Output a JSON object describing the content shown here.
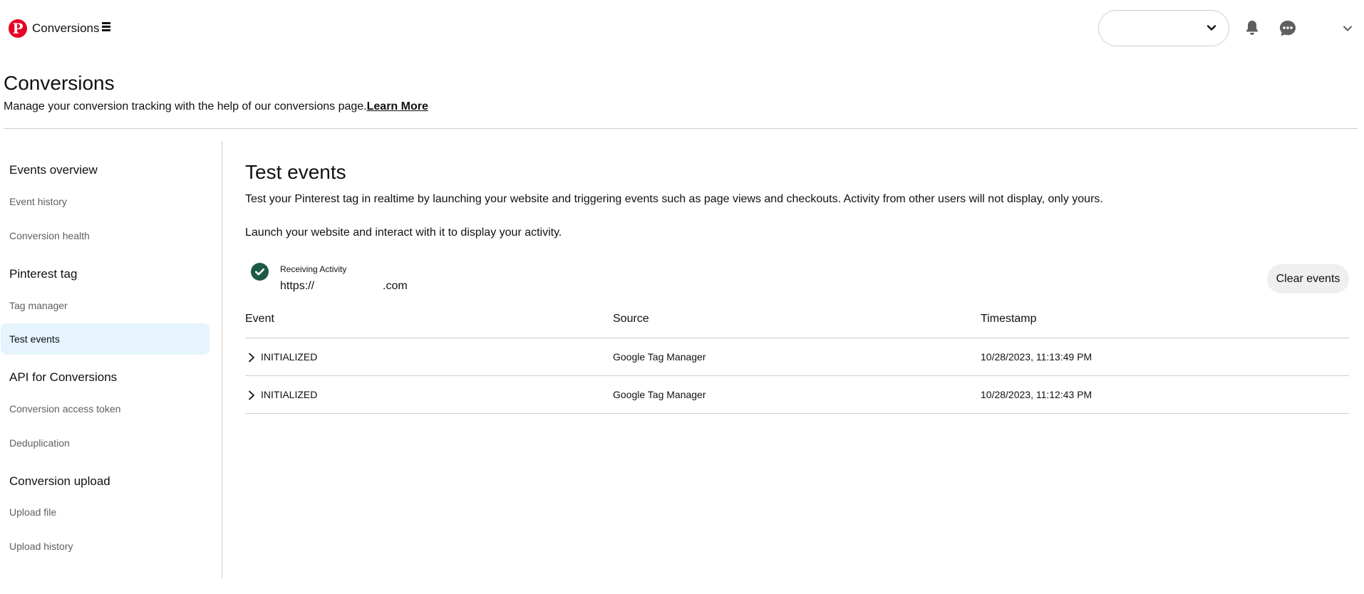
{
  "topbar": {
    "app_name": "Conversions",
    "icons": {
      "logo": "pinterest-logo",
      "menu": "menu-icon",
      "account_select_chevron": "chevron-down-icon",
      "notifications": "bell-icon",
      "messages": "chat-icon",
      "profile_menu": "chevron-down-icon"
    }
  },
  "header": {
    "title": "Conversions",
    "subtitle": "Manage your conversion tracking with the help of our conversions page.",
    "learn_more": "Learn More"
  },
  "sidebar": {
    "sections": [
      {
        "title": "Events overview",
        "items": [
          "Event history",
          "Conversion health"
        ]
      },
      {
        "title": "Pinterest tag",
        "items": [
          "Tag manager",
          "Test events"
        ]
      },
      {
        "title": "API for Conversions",
        "items": [
          "Conversion access token",
          "Deduplication"
        ]
      },
      {
        "title": "Conversion upload",
        "items": [
          "Upload file",
          "Upload history"
        ]
      }
    ],
    "active_item": "Test events"
  },
  "main": {
    "title": "Test events",
    "description": "Test your Pinterest tag in realtime by launching your website and triggering events such as page views and checkouts. Activity from other users will not display, only yours.",
    "launch_text": "Launch your website and interact with it to display your activity.",
    "status": {
      "label": "Receiving Activity",
      "url_prefix": "https://",
      "url_suffix": ".com"
    },
    "clear_button": "Clear events",
    "table": {
      "columns": [
        "Event",
        "Source",
        "Timestamp"
      ],
      "rows": [
        {
          "event": "INITIALIZED",
          "source": "Google Tag Manager",
          "timestamp": "10/28/2023, 11:13:49 PM"
        },
        {
          "event": "INITIALIZED",
          "source": "Google Tag Manager",
          "timestamp": "10/28/2023, 11:12:43 PM"
        }
      ]
    }
  },
  "colors": {
    "brand": "#e60023",
    "success": "#1e5943",
    "active_nav_bg": "#e5f4fd",
    "divider": "#cdcdcd",
    "secondary_button_bg": "#efefef"
  }
}
